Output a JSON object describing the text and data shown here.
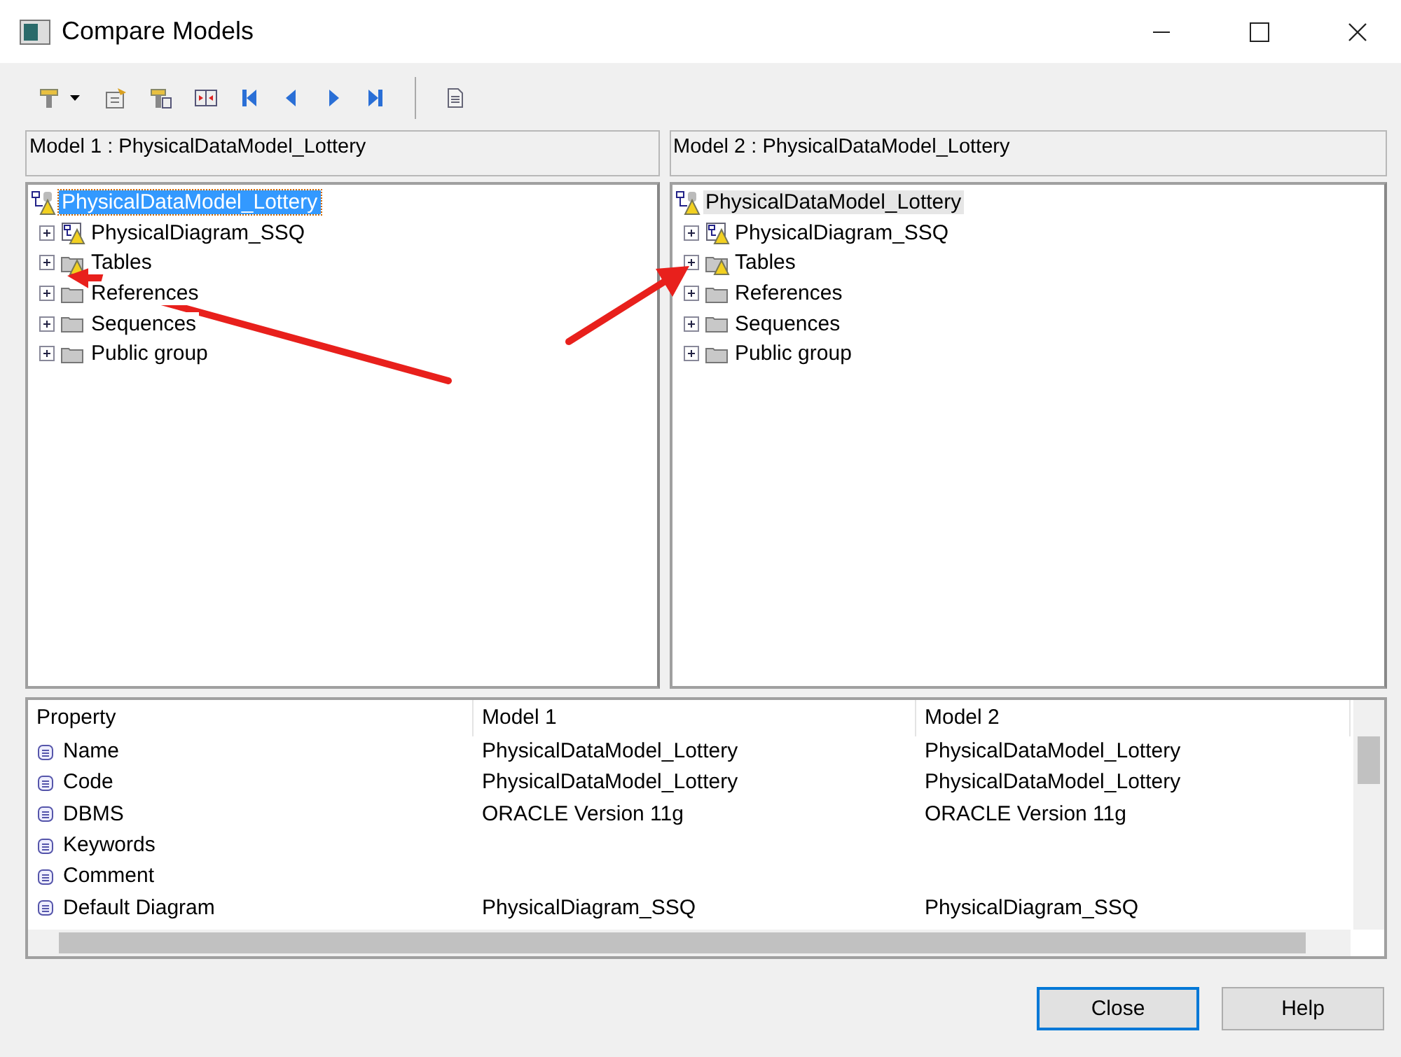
{
  "window": {
    "title": "Compare Models"
  },
  "toolbar": [
    {
      "kind": "model-menu"
    },
    {
      "kind": "properties"
    },
    {
      "kind": "compare-properties"
    },
    {
      "kind": "side-by-side"
    },
    {
      "kind": "first"
    },
    {
      "kind": "previous"
    },
    {
      "kind": "next"
    },
    {
      "kind": "last"
    },
    {
      "kind": "separator"
    },
    {
      "kind": "report"
    }
  ],
  "panes": [
    {
      "header": "Model 1 : PhysicalDataModel_Lottery",
      "root": {
        "label": "PhysicalDataModel_Lottery",
        "warning": true,
        "selected": true,
        "focused": true,
        "children": [
          {
            "label": "PhysicalDiagram_SSQ",
            "kind": "diagram",
            "warning": true,
            "expanded": false
          },
          {
            "label": "Tables",
            "kind": "folder",
            "warning": true,
            "expanded": false
          },
          {
            "label": "References",
            "kind": "folder",
            "warning": false,
            "expanded": false
          },
          {
            "label": "Sequences",
            "kind": "folder",
            "warning": false,
            "expanded": false
          },
          {
            "label": "Public group",
            "kind": "folder",
            "warning": false,
            "expanded": false
          }
        ]
      }
    },
    {
      "header": "Model 2 : PhysicalDataModel_Lottery",
      "root": {
        "label": "PhysicalDataModel_Lottery",
        "warning": true,
        "selected": true,
        "focused": false,
        "children": [
          {
            "label": "PhysicalDiagram_SSQ",
            "kind": "diagram",
            "warning": true,
            "expanded": false
          },
          {
            "label": "Tables",
            "kind": "folder",
            "warning": true,
            "expanded": false
          },
          {
            "label": "References",
            "kind": "folder",
            "warning": false,
            "expanded": false
          },
          {
            "label": "Sequences",
            "kind": "folder",
            "warning": false,
            "expanded": false
          },
          {
            "label": "Public group",
            "kind": "folder",
            "warning": false,
            "expanded": false
          }
        ]
      }
    }
  ],
  "properties": {
    "columns": [
      "Property",
      "Model 1",
      "Model 2"
    ],
    "rows": [
      [
        "Name",
        "PhysicalDataModel_Lottery",
        "PhysicalDataModel_Lottery"
      ],
      [
        "Code",
        "PhysicalDataModel_Lottery",
        "PhysicalDataModel_Lottery"
      ],
      [
        "DBMS",
        "ORACLE Version 11g",
        "ORACLE Version 11g"
      ],
      [
        "Keywords",
        "",
        ""
      ],
      [
        "Comment",
        "",
        ""
      ],
      [
        "Default Diagram",
        "PhysicalDiagram_SSQ",
        "PhysicalDiagram_SSQ"
      ]
    ]
  },
  "buttons": [
    {
      "label": "Close",
      "default": true
    },
    {
      "label": "Help",
      "default": false
    }
  ],
  "annotations": [
    {
      "kind": "arrow"
    },
    {
      "kind": "arrow"
    }
  ]
}
